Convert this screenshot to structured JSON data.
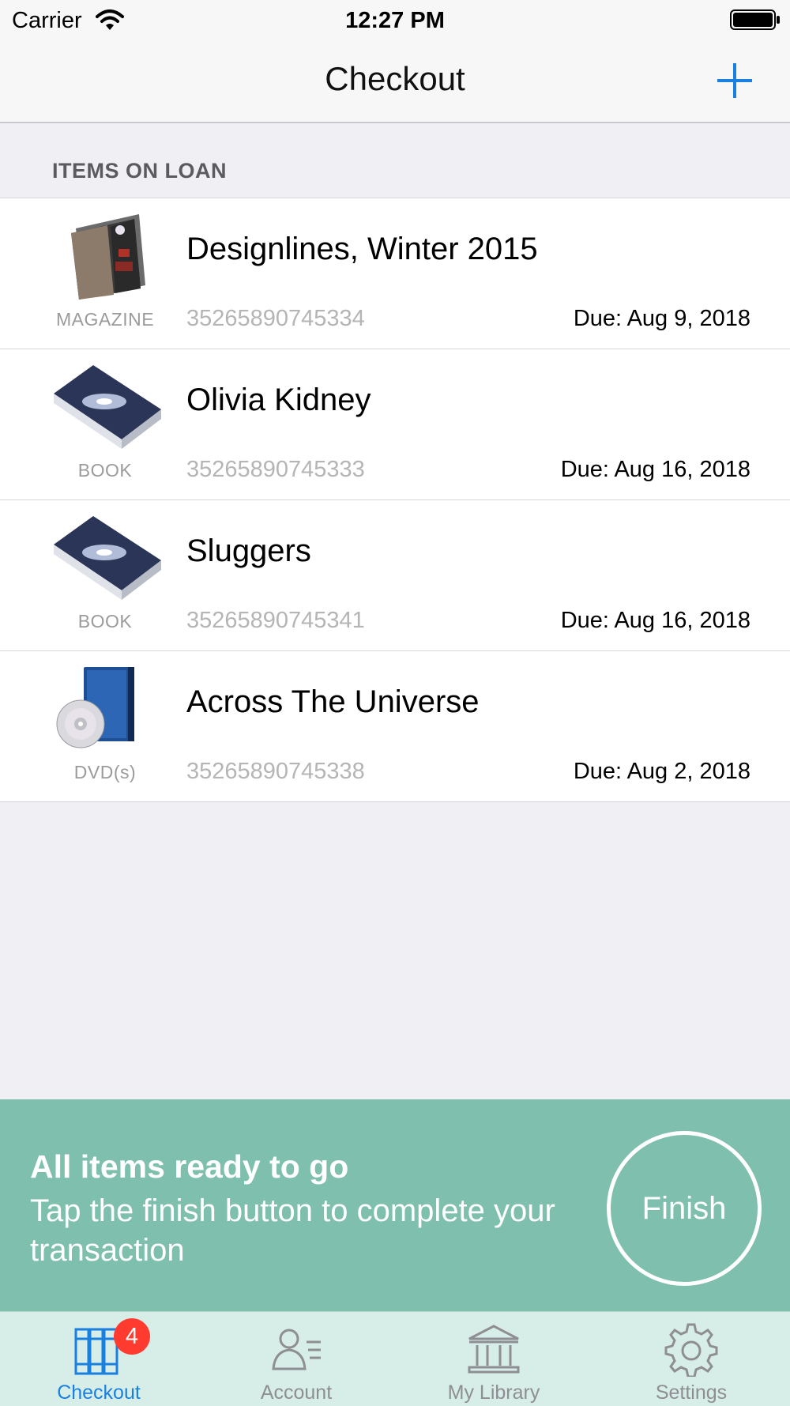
{
  "status_bar": {
    "carrier": "Carrier",
    "time": "12:27 PM",
    "icons": [
      "wifi-icon",
      "battery-icon"
    ]
  },
  "nav": {
    "title": "Checkout",
    "add_icon": "plus-icon",
    "accent_color": "#1a80e0"
  },
  "section": {
    "header": "ITEMS ON LOAN"
  },
  "items": [
    {
      "type": "MAGAZINE",
      "title": "Designlines, Winter 2015",
      "barcode": "35265890745334",
      "due": "Due: Aug 9, 2018",
      "icon": "magazine-icon"
    },
    {
      "type": "BOOK",
      "title": "Olivia Kidney",
      "barcode": "35265890745333",
      "due": "Due: Aug 16, 2018",
      "icon": "book-icon"
    },
    {
      "type": "BOOK",
      "title": "Sluggers",
      "barcode": "35265890745341",
      "due": "Due: Aug 16, 2018",
      "icon": "book-icon"
    },
    {
      "type": "DVD(s)",
      "title": "Across The Universe",
      "barcode": "35265890745338",
      "due": "Due: Aug 2, 2018",
      "icon": "dvd-icon"
    }
  ],
  "banner": {
    "heading": "All items ready to go",
    "message": "Tap the finish button to complete your transaction",
    "finish_label": "Finish",
    "background_color": "#7fbfad"
  },
  "tabs": [
    {
      "label": "Checkout",
      "icon": "books-icon",
      "active": true,
      "badge": "4"
    },
    {
      "label": "Account",
      "icon": "account-icon",
      "active": false
    },
    {
      "label": "My Library",
      "icon": "library-icon",
      "active": false
    },
    {
      "label": "Settings",
      "icon": "gear-icon",
      "active": false
    }
  ]
}
